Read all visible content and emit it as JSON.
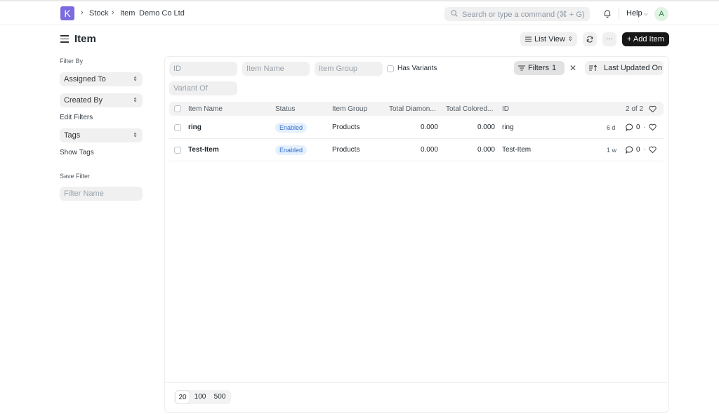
{
  "nav": {
    "logo_letter": "K",
    "breadcrumbs": [
      "Stock",
      "Item",
      "Demo Co Ltd"
    ],
    "search_placeholder": "Search or type a command (⌘ + G)",
    "help_label": "Help",
    "avatar_letter": "A"
  },
  "page": {
    "title": "Item",
    "list_view_label": "List View",
    "more_label": "···",
    "add_label": "+ Add Item"
  },
  "sidebar": {
    "filter_by_label": "Filter By",
    "assigned_to": "Assigned To",
    "created_by": "Created By",
    "edit_filters": "Edit Filters",
    "tags": "Tags",
    "show_tags": "Show Tags",
    "save_filter_label": "Save Filter",
    "filter_name_placeholder": "Filter Name"
  },
  "filters": {
    "id_placeholder": "ID",
    "item_name_placeholder": "Item Name",
    "item_group_placeholder": "Item Group",
    "has_variants_label": "Has Variants",
    "variant_of_placeholder": "Variant Of",
    "filters_label": "Filters",
    "filters_count": "1",
    "clear_label": "✕",
    "sort_label": "Last Updated On"
  },
  "table": {
    "headers": [
      "Item Name",
      "Status",
      "Item Group",
      "Total Diamon...",
      "Total Colored...",
      "ID"
    ],
    "count_label": "2 of 2",
    "rows": [
      {
        "name": "ring",
        "status": "Enabled",
        "group": "Products",
        "diamond": "0.000",
        "colored": "0.000",
        "id": "ring",
        "age": "6 d",
        "comments": "0"
      },
      {
        "name": "Test-Item",
        "status": "Enabled",
        "group": "Products",
        "diamond": "0.000",
        "colored": "0.000",
        "id": "Test-Item",
        "age": "1 w",
        "comments": "0"
      }
    ]
  },
  "pagination": {
    "sizes": [
      "20",
      "100",
      "500"
    ],
    "active": "20"
  },
  "colors": {
    "logo": "#7a6be0",
    "primary_button": "#171717",
    "badge_bg": "#e6f0fd",
    "badge_text": "#2f6fca"
  }
}
